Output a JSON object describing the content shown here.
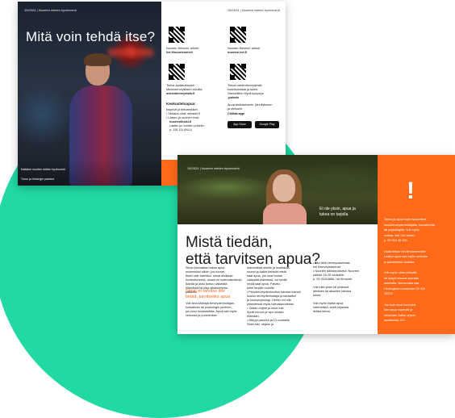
{
  "colors": {
    "teal": "#21d9a4",
    "orange": "#ff6a1a"
  },
  "top_doc": {
    "brand": "15/2024 | Nuorten mielen hyvinvointi",
    "brand_right": "15/2024 | Nuorten mielen hyvinvointi",
    "title": "Mitä voin tehdä itse?",
    "qr1_caption_a": "Nuorten Helsinki: aiheet",
    "qr1_caption_b": "hel.fi/nuortenmieli",
    "qr2_caption_a": "Nuorten Helsinki: aiheet",
    "qr2_caption_b": "nuorten.hel.fi",
    "qr3_caption_a": "Tietoa ahdistuksesta",
    "qr3_caption_b": "Mielenterveystalon sivuilta:",
    "qr3_caption_c": "mielenterveystalo.fi",
    "qr4_caption_a": "Tietoa mielenterveydestä,",
    "qr4_caption_b": "kokemuksista ja tukea",
    "qr4_caption_c": "Väestöliiton Hyvä kysymys",
    "qr4_caption_d": "-palvelu",
    "keskustelu_title": "Keskusteluapua:",
    "keskustelu_l1": "Inspiroit ja tietoarkkiset",
    "keskustelu_l2": "• Sekasin chat: sekasin.fi",
    "keskustelu_l3": "• Lasten ja nuorten chat:",
    "keskustelu_l4": "nuortenlinkki.fi",
    "keskustelu_l5": "Lasten ja nuorten puhelin:",
    "keskustelu_l6": "p. 116 111 (MLL)",
    "app_l1": "Apua ahdistukseen, jännitykseen",
    "app_l2": "ja stressiin:",
    "app_l3": "Chillaa appi",
    "store1": "App Store",
    "store2": "Google Play",
    "footer1": "Kaikkien nuorten mielen hyvinvointi",
    "footer2": "Turun ja Helsingin palvelut"
  },
  "bottom_doc": {
    "brand": "15/2024 | Nuorten mielen hyvinvointi",
    "caption_l1": "Et ole yksin, apua ja",
    "caption_l2": "tukea on tarjolla.",
    "headline_l1": "Mistä tiedän,",
    "headline_l2": "että tarvitsen apua?",
    "sub_l1": "Sinun ei tarvitse itse",
    "sub_l2": "tietää, tarvitsetko apua",
    "col1": [
      "Sinun kannattaa hakea apua",
      "esimerkiksi silloin, jos tunnet",
      "itsesi vain harmiksi, sinua ahdistaa",
      "huolestuneesti, olosta on todennäköisesti",
      "ikävää ja olosi tuntuu vaikealta",
      "elämässä tai käyt aikaisempaa",
      "palautta."
    ],
    "col1b": [
      "Voit aina kääntyä terveydenhoitajan,",
      "kuraattorin tai psykologin puoleen,",
      "jos olosi huolestuttaa. Apua saa myös",
      "verkosta ja puhelimitse."
    ],
    "col2": [
      "mahdollista sinulle ja huoltakaa,",
      "nuoret ja kaikki tietävät mistä",
      "saat apua, jos olosi tuntuu",
      "vaikealta elämässä, voi tiedät",
      "mistä saat apua. Palvelu",
      "tulee tarjolle nuorille."
    ],
    "col2_list": [
      "• Perusterveydenhuollon kanssa tulevat",
      "koulun terveydenhoitaja ja kuraattori",
      "ja koulupsykologi. Heihin voi olla",
      "yhteydessä myös tulevaisuudessa.",
      "• Tolaan ohjeet ja muut tuki:",
      "hyvät neuvot ja apu omaan",
      "elämään.",
      "• Mieppi palvelut ja 13 vuotiaille",
      "Sekä tuki, ohjaus ja"
    ],
    "col3": [
      "• Etsi lähin terveysasemasi:",
      "hel.fi/terveysasemat",
      "• Nuorten päihdepalvelut: Nuorten",
      "päihde 15-25 vuotiaille:",
      "p. 09 31024856, hel.fi/nuoret",
      "",
      "Voit tulla yksin tai yhdessä",
      "läheisen tai aikuisen kanssa",
      "tukea.",
      "",
      "Voit myös löytää apua",
      "internetistä, sekä ohjausta",
      "lisäksi tietoa."
    ],
    "orange_text": [
      "Tietoa ja apua saat esimerkiksi",
      "kouluterveydenhoitajalta, kuraattorilta",
      "tai psykologilta. Voit myös",
      "soittaa. Alle 18v tueksi",
      "p. 09 310 46 100.",
      "",
      "Lisää tietoa: hel.fi/nuortenmieli",
      "Lisäksi apua saa myös verkosta",
      "ja puhelimitse chatista.",
      "",
      "Voit myös ottaa yhteyttä",
      "tai kysyä neuvoa suoraan",
      "asemalta. Neuvontaa saa",
      "Helsingissä numerosta 09 310",
      "10023.",
      "",
      "Jos koet olosi huonoksi,",
      "hae apua nopeasti ja",
      "rohkeasti. Katso ohjeet",
      "osoitteesta 112."
    ]
  }
}
